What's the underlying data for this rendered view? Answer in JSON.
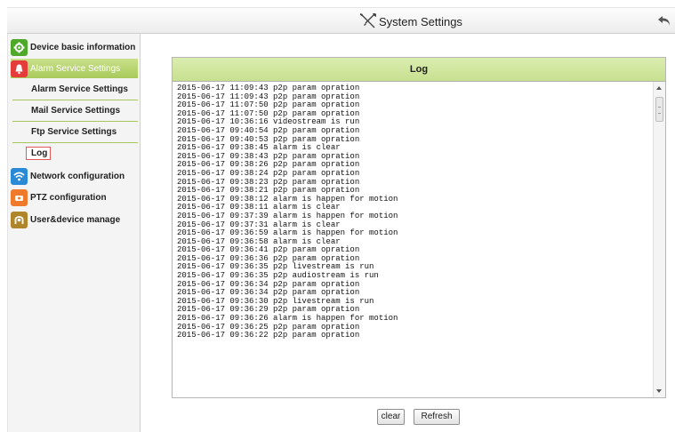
{
  "header": {
    "title": "System Settings",
    "title_icon": "tools-icon",
    "back_icon": "back-arrow-icon"
  },
  "sidebar": {
    "items": [
      {
        "label": "Device basic information",
        "icon": "gear-icon",
        "color": "#4ea82a"
      },
      {
        "label": "Alarm Service Settings",
        "icon": "bell-icon",
        "color": "#e53b3b"
      },
      {
        "label": "Network configuration",
        "icon": "wifi-icon",
        "color": "#2a8ad6"
      },
      {
        "label": "PTZ configuration",
        "icon": "ptz-icon",
        "color": "#ef7a2b"
      },
      {
        "label": "User&device manage",
        "icon": "user-icon",
        "color": "#b0852a"
      }
    ],
    "subitems": [
      {
        "label": "Alarm Service Settings"
      },
      {
        "label": "Mail Service Settings"
      },
      {
        "label": "Ftp Service Settings"
      },
      {
        "label": "Log"
      }
    ]
  },
  "log": {
    "title": "Log",
    "lines": [
      "2015-06-17 11:09:43 p2p param opration",
      "2015-06-17 11:09:43 p2p param opration",
      "2015-06-17 11:07:50 p2p param opration",
      "2015-06-17 11:07:50 p2p param opration",
      "2015-06-17 10:36:16 videostream is run",
      "2015-06-17 09:40:54 p2p param opration",
      "2015-06-17 09:40:53 p2p param opration",
      "2015-06-17 09:38:45 alarm is clear",
      "2015-06-17 09:38:43 p2p param opration",
      "2015-06-17 09:38:26 p2p param opration",
      "2015-06-17 09:38:24 p2p param opration",
      "2015-06-17 09:38:23 p2p param opration",
      "2015-06-17 09:38:21 p2p param opration",
      "2015-06-17 09:38:12 alarm is happen for motion",
      "2015-06-17 09:38:11 alarm is clear",
      "2015-06-17 09:37:39 alarm is happen for motion",
      "2015-06-17 09:37:31 alarm is clear",
      "2015-06-17 09:36:59 alarm is happen for motion",
      "2015-06-17 09:36:58 alarm is clear",
      "2015-06-17 09:36:41 p2p param opration",
      "2015-06-17 09:36:36 p2p param opration",
      "2015-06-17 09:36:35 p2p livestream is run",
      "2015-06-17 09:36:35 p2p audiostream is run",
      "2015-06-17 09:36:34 p2p param opration",
      "2015-06-17 09:36:34 p2p param opration",
      "2015-06-17 09:36:30 p2p livestream is run",
      "2015-06-17 09:36:29 p2p param opration",
      "2015-06-17 09:36:26 alarm is happen for motion",
      "2015-06-17 09:36:25 p2p param opration",
      "2015-06-17 09:36:22 p2p param opration"
    ]
  },
  "buttons": {
    "clear": "clear",
    "refresh": "Refresh"
  }
}
